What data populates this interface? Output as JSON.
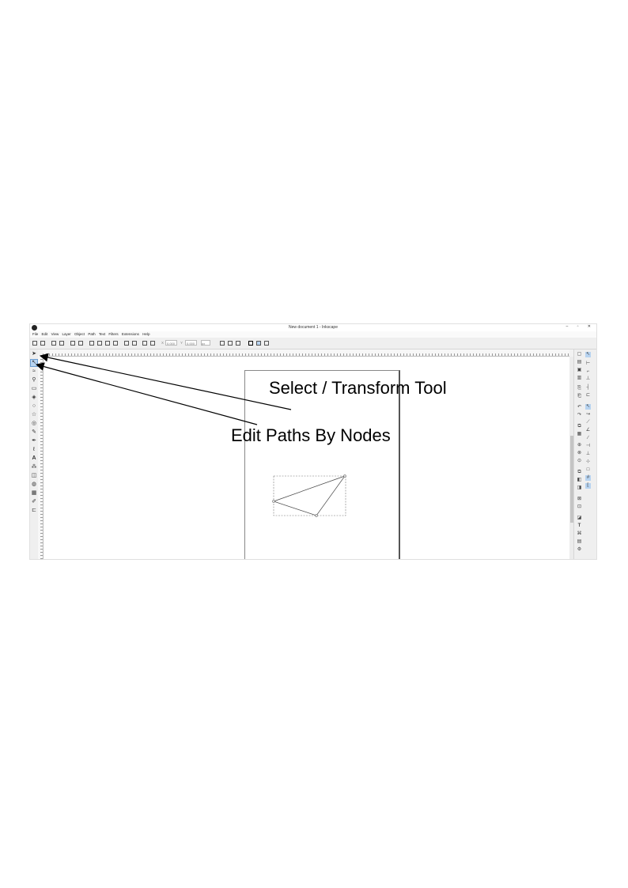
{
  "window": {
    "title": "New document 1 - Inkscape",
    "controls": "–  ▫  ✕"
  },
  "menu": [
    "File",
    "Edit",
    "View",
    "Layer",
    "Object",
    "Path",
    "Text",
    "Filters",
    "Extensions",
    "Help"
  ],
  "command_bar": {
    "x_label": "X",
    "x_value": "0.000",
    "y_label": "Y",
    "y_value": "0.000",
    "unit": "px"
  },
  "tools": [
    {
      "name": "selector-tool",
      "glyph": "➤",
      "active": false
    },
    {
      "name": "node-tool",
      "glyph": "↖",
      "active": true
    },
    {
      "name": "tweak-tool",
      "glyph": "≈",
      "active": false
    },
    {
      "name": "zoom-tool",
      "glyph": "⚲",
      "active": false
    },
    {
      "name": "rect-tool",
      "glyph": "▭",
      "active": false
    },
    {
      "name": "3dbox-tool",
      "glyph": "◈",
      "active": false
    },
    {
      "name": "ellipse-tool",
      "glyph": "○",
      "active": false
    },
    {
      "name": "star-tool",
      "glyph": "☆",
      "active": false
    },
    {
      "name": "spiral-tool",
      "glyph": "◎",
      "active": false
    },
    {
      "name": "pencil-tool",
      "glyph": "✎",
      "active": false
    },
    {
      "name": "pen-tool",
      "glyph": "✒",
      "active": false
    },
    {
      "name": "calligraphy-tool",
      "glyph": "ℓ",
      "active": false
    },
    {
      "name": "text-tool",
      "glyph": "A",
      "active": false
    },
    {
      "name": "spray-tool",
      "glyph": "⁂",
      "active": false
    },
    {
      "name": "eraser-tool",
      "glyph": "◫",
      "active": false
    },
    {
      "name": "paint-bucket-tool",
      "glyph": "◍",
      "active": false
    },
    {
      "name": "gradient-tool",
      "glyph": "▦",
      "active": false
    },
    {
      "name": "dropper-tool",
      "glyph": "✐",
      "active": false
    },
    {
      "name": "connector-tool",
      "glyph": "⊏",
      "active": false
    }
  ],
  "annotations": {
    "select_label": "Select / Transform Tool",
    "nodes_label": "Edit Paths By Nodes"
  }
}
